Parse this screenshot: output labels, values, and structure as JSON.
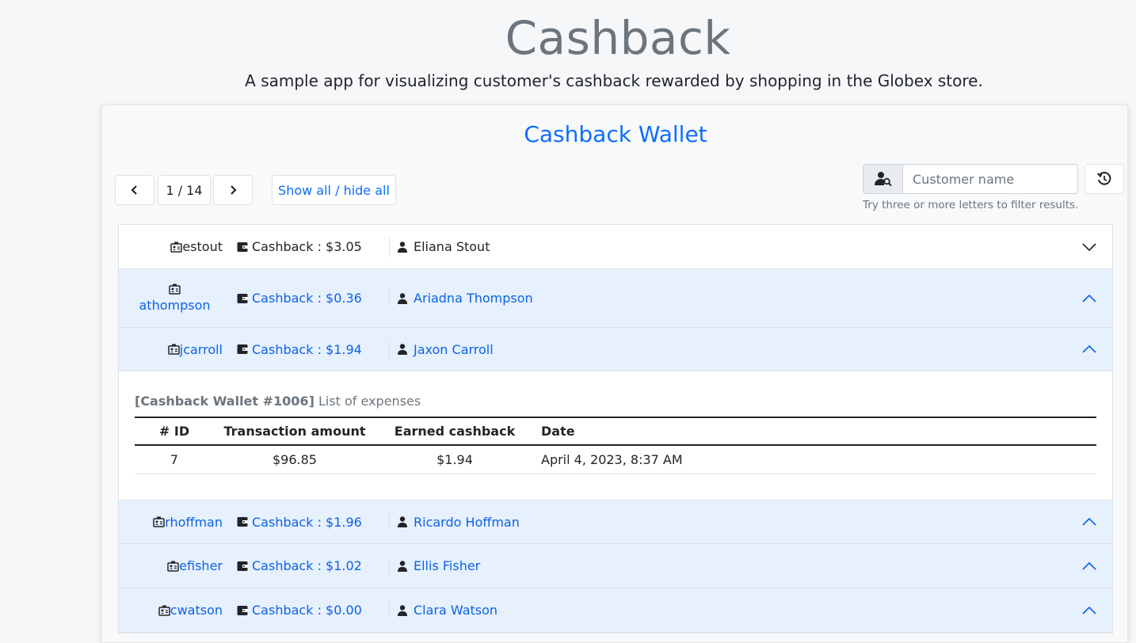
{
  "app": {
    "title": "Cashback",
    "subtitle": "A sample app for visualizing customer's cashback rewarded by shopping in the Globex store."
  },
  "wallet": {
    "title": "Cashback Wallet",
    "pager": {
      "label": "1 / 14",
      "prev_icon": "chevron-left-icon",
      "next_icon": "chevron-right-icon"
    },
    "toggle_label": "Show all / hide all",
    "search": {
      "placeholder": "Customer name",
      "value": "",
      "hint": "Try three or more letters to filter results.",
      "icon": "user-search-icon",
      "refresh_icon": "refresh-icon"
    }
  },
  "customers": [
    {
      "username": "estout",
      "cashback": "Cashback : $3.05",
      "name": "Eliana Stout",
      "state": "closed"
    },
    {
      "username": "athompson",
      "cashback": "Cashback : $0.36",
      "name": "Ariadna Thompson",
      "state": "open"
    },
    {
      "username": "jcarroll",
      "cashback": "Cashback : $1.94",
      "name": "Jaxon Carroll",
      "state": "open"
    },
    {
      "username": "rhoffman",
      "cashback": "Cashback : $1.96",
      "name": "Ricardo Hoffman",
      "state": "open"
    },
    {
      "username": "efisher",
      "cashback": "Cashback : $1.02",
      "name": "Ellis Fisher",
      "state": "open"
    },
    {
      "username": "cwatson",
      "cashback": "Cashback : $0.00",
      "name": "Clara Watson",
      "state": "open"
    }
  ],
  "detail": {
    "caption_bold": "[Cashback Wallet #1006]",
    "caption_text": " List of expenses",
    "headers": {
      "id": "# ID",
      "amount": "Transaction amount",
      "earned": "Earned cashback",
      "date": "Date"
    },
    "rows": [
      {
        "id": "7",
        "amount": "$96.85",
        "earned": "$1.94",
        "date": "April 4, 2023, 8:37 AM"
      }
    ]
  },
  "colors": {
    "accent": "#0d6efd",
    "open_bg": "#e7f0fd",
    "muted": "#6c757d"
  }
}
